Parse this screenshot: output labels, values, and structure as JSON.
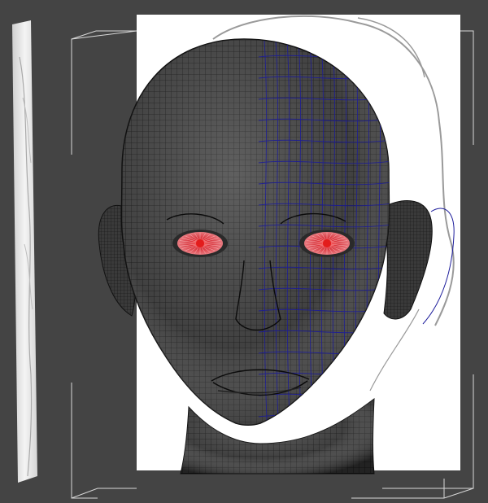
{
  "viewport": {
    "background": "#444444",
    "view": "front"
  },
  "colors": {
    "mesh_dark": "#3a3a3a",
    "mesh_line": "#111111",
    "wire_blue": "#1a1a9a",
    "eye_red": "#e0343c",
    "bracket": "#d8d8d8",
    "sheet": "#ffffff"
  },
  "scene": {
    "objects": [
      "head-mesh",
      "eye-left",
      "eye-right",
      "reference-image-plane",
      "side-reference-plane",
      "bounding-box"
    ]
  }
}
